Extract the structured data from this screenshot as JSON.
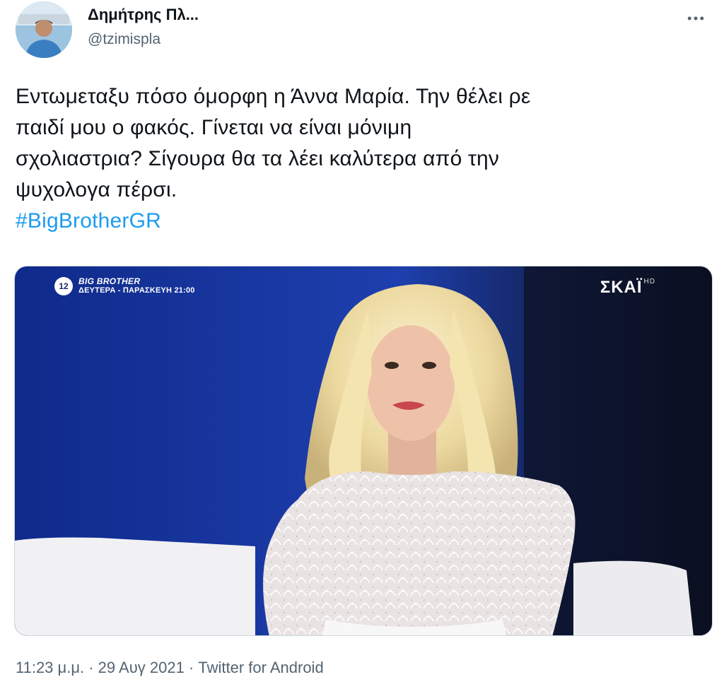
{
  "author": {
    "display_name": "Δημήτρης Πλ...",
    "handle": "@tzimispla",
    "avatar_icon": "avatar-photo"
  },
  "more_icon": "more-horizontal-icon",
  "tweet": {
    "lines": [
      "Εντωμεταξυ πόσο όμορφη η Άννα Μαρία. Την θέλει ρε",
      "παιδί μου ο φακός. Γίνεται να είναι μόνιμη",
      "σχολιαστρια? Σίγουρα θα τα λέει καλύτερα από την",
      "ψυχολογα πέρσι."
    ],
    "hashtag": "#BigBrotherGR"
  },
  "media": {
    "channel_number": "12",
    "show_title": "BIG BROTHER",
    "show_schedule": "ΔΕΥΤΕΡΑ - ΠΑΡΑΣΚΕΥΗ 21:00",
    "channel_logo": "ΣΚΑΪ",
    "channel_logo_suffix": "HD"
  },
  "footer": {
    "time": "11:23 μ.μ.",
    "separator": " · ",
    "date": "29 Αυγ 2021",
    "source": "Twitter for Android"
  },
  "colors": {
    "link": "#1d9bf0",
    "secondary_text": "#536471",
    "primary_text": "#0f1419"
  }
}
